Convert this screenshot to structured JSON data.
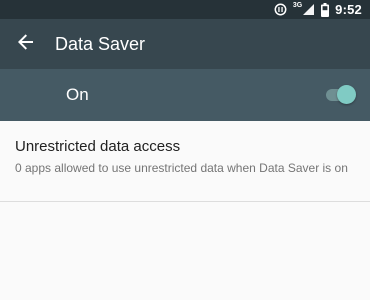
{
  "status_bar": {
    "time": "9:52",
    "network_type": "3G",
    "icons": [
      "data-saver-icon",
      "cell-signal-icon",
      "battery-icon"
    ]
  },
  "app_bar": {
    "back_icon": "arrow-back-icon",
    "title": "Data Saver"
  },
  "master_switch": {
    "label": "On",
    "checked": true
  },
  "settings": [
    {
      "title": "Unrestricted data access",
      "summary": "0 apps allowed to use unrestricted data when Data Saver is on"
    }
  ],
  "colors": {
    "status_bar": "#263238",
    "app_bar": "#37474f",
    "switch_bar": "#455a64",
    "accent": "#80cbc4",
    "background": "#fafafa"
  }
}
